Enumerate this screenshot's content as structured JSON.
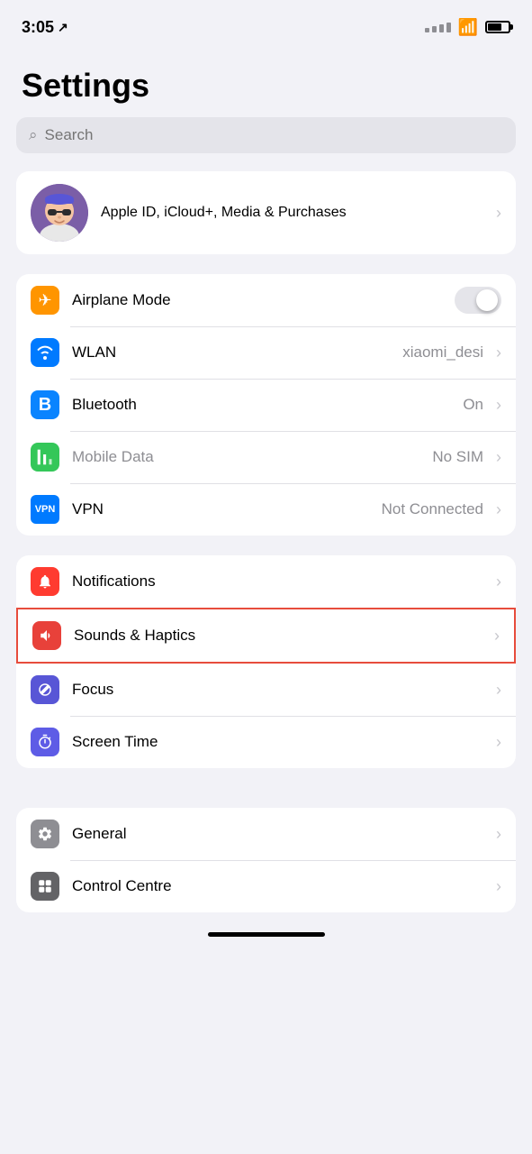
{
  "statusBar": {
    "time": "3:05",
    "locationIcon": "↗",
    "battery": 70
  },
  "title": "Settings",
  "search": {
    "placeholder": "Search"
  },
  "appleId": {
    "label": "Apple ID, iCloud+, Media & Purchases"
  },
  "connectivityGroup": [
    {
      "id": "airplane-mode",
      "label": "Airplane Mode",
      "iconBg": "bg-orange",
      "iconGlyph": "✈",
      "type": "toggle",
      "toggleOn": false,
      "value": ""
    },
    {
      "id": "wlan",
      "label": "WLAN",
      "iconBg": "bg-blue",
      "iconGlyph": "📶",
      "type": "chevron",
      "value": "xiaomi_desi"
    },
    {
      "id": "bluetooth",
      "label": "Bluetooth",
      "iconBg": "bg-blue-dark",
      "iconGlyph": "ᛒ",
      "type": "chevron",
      "value": "On"
    },
    {
      "id": "mobile-data",
      "label": "Mobile Data",
      "iconBg": "bg-green",
      "iconGlyph": "📡",
      "type": "chevron",
      "value": "No SIM",
      "muted": true
    },
    {
      "id": "vpn",
      "label": "VPN",
      "iconBg": "bg-vpn",
      "iconGlyph": "VPN",
      "type": "chevron",
      "value": "Not Connected"
    }
  ],
  "notificationsGroup": [
    {
      "id": "notifications",
      "label": "Notifications",
      "iconBg": "bg-red",
      "iconGlyph": "🔔",
      "highlighted": false
    },
    {
      "id": "sounds-haptics",
      "label": "Sounds & Haptics",
      "iconBg": "bg-pink-red",
      "iconGlyph": "🔊",
      "highlighted": true
    },
    {
      "id": "focus",
      "label": "Focus",
      "iconBg": "bg-purple",
      "iconGlyph": "🌙"
    },
    {
      "id": "screen-time",
      "label": "Screen Time",
      "iconBg": "bg-purple-dark",
      "iconGlyph": "⏳"
    }
  ],
  "generalGroup": [
    {
      "id": "general",
      "label": "General",
      "iconBg": "bg-gray",
      "iconGlyph": "⚙"
    },
    {
      "id": "control-centre",
      "label": "Control Centre",
      "iconBg": "bg-gray2",
      "iconGlyph": "🎛"
    }
  ]
}
